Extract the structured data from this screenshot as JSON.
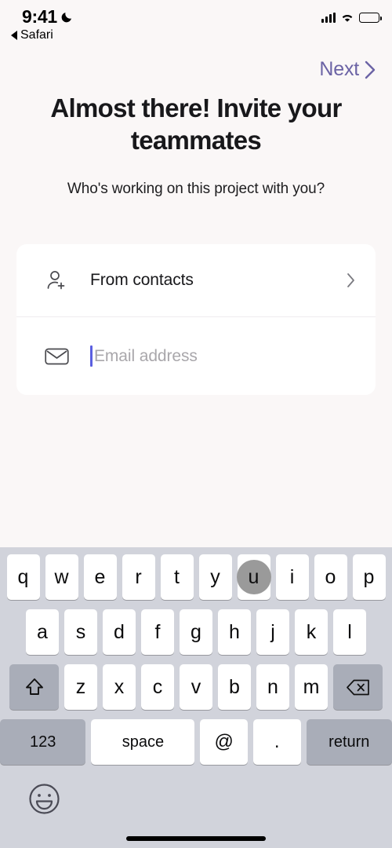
{
  "status_bar": {
    "time": "9:41",
    "dnd_icon": "moon-icon",
    "back_app_label": "Safari",
    "back_icon": "back-triangle-icon",
    "signal_icon": "cellular-signal-icon",
    "wifi_icon": "wifi-icon",
    "battery_icon": "battery-full-icon"
  },
  "nav": {
    "next_label": "Next",
    "next_chevron_icon": "chevron-right-icon",
    "next_color": "#6b63a5"
  },
  "page": {
    "title": "Almost there! Invite your teammates",
    "subtitle": "Who's working on this project with you?"
  },
  "invite_card": {
    "contacts_row": {
      "icon": "person-add-icon",
      "label": "From contacts",
      "chevron_icon": "chevron-right-icon"
    },
    "email_row": {
      "icon": "envelope-icon",
      "placeholder": "Email address",
      "value": "",
      "caret_color": "#5b5fe0"
    }
  },
  "keyboard": {
    "type": "email-address",
    "background_color": "#d1d3db",
    "active_key": "u",
    "rows": [
      [
        "q",
        "w",
        "e",
        "r",
        "t",
        "y",
        "u",
        "i",
        "o",
        "p"
      ],
      [
        "a",
        "s",
        "d",
        "f",
        "g",
        "h",
        "j",
        "k",
        "l"
      ],
      [
        "z",
        "x",
        "c",
        "v",
        "b",
        "n",
        "m"
      ]
    ],
    "shift_key": "shift-icon",
    "backspace_key": "backspace-icon",
    "bottom_row": {
      "numbers_label": "123",
      "space_label": "space",
      "at_label": "@",
      "period_label": ".",
      "return_label": "return"
    },
    "emoji_key_icon": "emoji-smiley-icon"
  }
}
